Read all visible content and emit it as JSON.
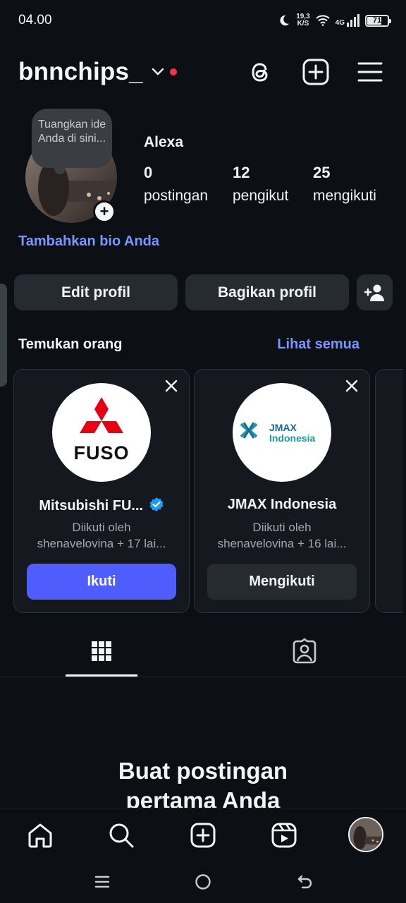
{
  "status_bar": {
    "time": "04.00",
    "net_speed": "19,3",
    "net_unit": "K/S",
    "network": "4G",
    "battery": "71",
    "battery_level": 0.71
  },
  "header": {
    "username": "bnnchips_",
    "icons": [
      "chevron-down-icon",
      "threads-icon",
      "create-post-icon",
      "menu-icon"
    ]
  },
  "profile": {
    "note": "Tuangkan ide Anda di sini...",
    "display_name": "Alexa",
    "stats": [
      {
        "value": "0",
        "label": "postingan"
      },
      {
        "value": "12",
        "label": "pengikut"
      },
      {
        "value": "25",
        "label": "mengikuti"
      }
    ],
    "add_bio": "Tambahkan bio Anda"
  },
  "actions": {
    "edit_profile": "Edit profil",
    "share_profile": "Bagikan profil"
  },
  "discover": {
    "title": "Temukan orang",
    "see_all": "Lihat semua",
    "cards": [
      {
        "name": "Mitsubishi FU...",
        "verified": true,
        "logo_text": "FUSO",
        "followed_by": "Diikuti oleh",
        "followers": "shenavelovina + 17 lai...",
        "button": "Ikuti"
      },
      {
        "name": "JMAX Indonesia",
        "verified": false,
        "logo_text_1": "JMAX",
        "logo_text_2": "Indonesia",
        "followed_by": "Diikuti oleh",
        "followers": "shenavelovina + 16 lai...",
        "button": "Mengikuti"
      }
    ]
  },
  "tabs": [
    "grid-icon",
    "tagged-icon"
  ],
  "empty_state": {
    "line1": "Buat postingan",
    "line2": "pertama Anda"
  },
  "bottom_nav": [
    "home-icon",
    "search-icon",
    "create-icon",
    "reels-icon",
    "profile-avatar"
  ],
  "colors": {
    "background": "#0c0f14",
    "accent": "#7b95ff",
    "follow_button": "#4f5dfc",
    "secondary_button": "#262a31",
    "notification_dot": "#ff3040",
    "verified": "#1d9bf0"
  }
}
